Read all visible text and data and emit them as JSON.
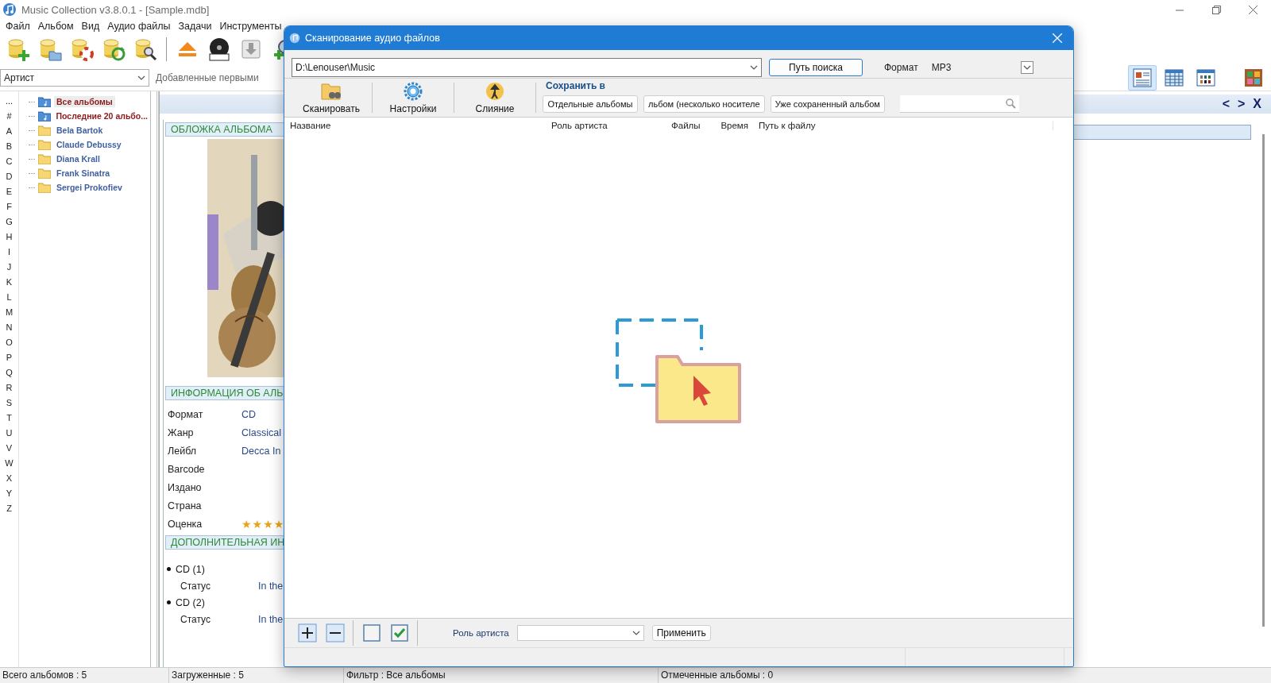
{
  "window": {
    "title": "Music Collection v3.8.0.1 - [Sample.mdb]"
  },
  "menu": [
    "Файл",
    "Альбом",
    "Вид",
    "Аудио файлы",
    "Задачи",
    "Инструменты"
  ],
  "filter_bar": {
    "group_by": "Артист",
    "sort": "Добавленные первыми"
  },
  "view_buttons": [
    {
      "kind": "details",
      "selected": true
    },
    {
      "kind": "list",
      "selected": false
    },
    {
      "kind": "grid",
      "selected": false
    },
    {
      "kind": "shelf",
      "selected": false
    }
  ],
  "alphabet": [
    "...",
    "#",
    "A",
    "B",
    "C",
    "D",
    "E",
    "F",
    "G",
    "H",
    "I",
    "J",
    "K",
    "L",
    "M",
    "N",
    "O",
    "P",
    "Q",
    "R",
    "S",
    "T",
    "U",
    "V",
    "W",
    "X",
    "Y",
    "Z"
  ],
  "tree": [
    {
      "label": "Все альбомы",
      "kind": "collection",
      "selected": true
    },
    {
      "label": "Последние 20 альбо...",
      "kind": "collection",
      "selected": false
    },
    {
      "label": "Bela Bartok",
      "kind": "artist",
      "selected": false
    },
    {
      "label": "Claude Debussy",
      "kind": "artist",
      "selected": false
    },
    {
      "label": "Diana Krall",
      "kind": "artist",
      "selected": false
    },
    {
      "label": "Frank Sinatra",
      "kind": "artist",
      "selected": false
    },
    {
      "label": "Sergei Prokofiev",
      "kind": "artist",
      "selected": false
    }
  ],
  "nav": {
    "prev": "<",
    "next": ">",
    "close": "X"
  },
  "detail": {
    "cover_header": "ОБЛОЖКА АЛЬБОМА",
    "info_header": "ИНФОРМАЦИЯ ОБ АЛЬ",
    "info": [
      {
        "label": "Формат",
        "value": "CD"
      },
      {
        "label": "Жанр",
        "value": "Classical"
      },
      {
        "label": "Лейбл",
        "value": "Decca In"
      },
      {
        "label": "Barcode"
      },
      {
        "label": "Издано"
      },
      {
        "label": "Страна"
      },
      {
        "label": "Оценка",
        "stars": 4
      }
    ],
    "extra_header": "ДОПОЛНИТЕЛЬНАЯ ИН",
    "discs": [
      {
        "name": "CD (1)",
        "status_label": "Статус",
        "status": "In the"
      },
      {
        "name": "CD (2)",
        "status_label": "Статус",
        "status": "In the"
      }
    ]
  },
  "dialog": {
    "title": "Сканирование аудио файлов",
    "path": "D:\\Lenouser\\Music",
    "search_path_button": "Путь поиска",
    "format_label": "Формат",
    "format": "MP3",
    "tools": [
      {
        "kind": "scan",
        "label": "Сканировать"
      },
      {
        "kind": "settings",
        "label": "Настройки"
      },
      {
        "kind": "merge",
        "label": "Слияние"
      }
    ],
    "save_in_label": "Сохранить в",
    "save_modes": [
      "Отдельные альбомы",
      "льбом (несколько носителе",
      "Уже сохраненный альбом"
    ],
    "columns": [
      "Название",
      "Роль артиста",
      "Файлы",
      "Время",
      "Путь к файлу"
    ],
    "artist_role_label": "Роль артиста",
    "apply_button": "Применить"
  },
  "status_bar": [
    "Всего альбомов : 5",
    "Загруженные : 5",
    "Фильтр : Все альбомы",
    "Отмеченные альбомы : 0"
  ]
}
